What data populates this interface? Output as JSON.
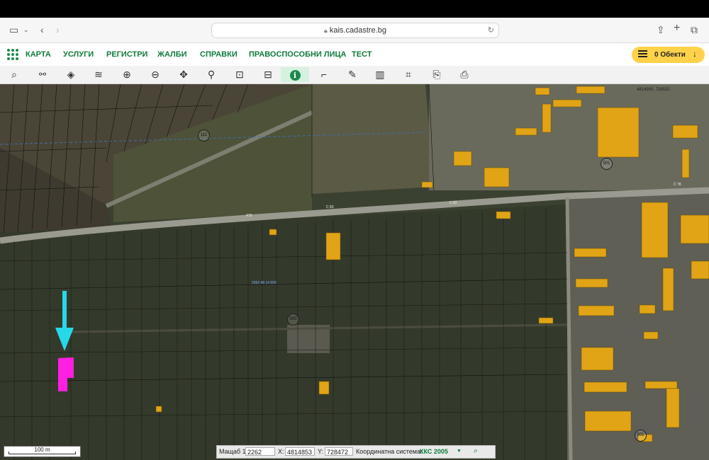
{
  "browser": {
    "url": "kais.cadastre.bg"
  },
  "menu": {
    "items": [
      "КАРТА",
      "УСЛУГИ",
      "РЕГИСТРИ",
      "ЖАЛБИ",
      "СПРАВКИ",
      "ПРАВОСПОСОБНИ ЛИЦА",
      "ТЕСТ"
    ],
    "objects_label": "0 Обекти"
  },
  "toolbar": {
    "tools": [
      "search-icon",
      "network-icon",
      "layers-icon",
      "layers-outline-icon",
      "zoom-in-icon",
      "zoom-out-icon",
      "pan-icon",
      "location-pin-icon",
      "add-rectangle-icon",
      "remove-rectangle-icon",
      "info-icon",
      "measure-icon",
      "draw-icon",
      "map-book-icon",
      "crop-icon",
      "export-icon",
      "print-icon"
    ],
    "active": "info-icon"
  },
  "map": {
    "parcel_circles": [
      "111",
      "501",
      "500",
      "501"
    ],
    "road_labels": [
      "C 83",
      "479",
      "C 82",
      "C 78"
    ],
    "corner_coords": "4814900, 728532",
    "mid_label": "2392 48 14 600",
    "colors": {
      "building": "#e0a416",
      "highlight": "#ff1fe0",
      "arrow": "#26d9e8",
      "parcel_line": "#1a1a1a"
    }
  },
  "scale": {
    "label": "100 m"
  },
  "status": {
    "scale_label": "Мащаб 1:",
    "scale_value": "2262",
    "x_label": "X:",
    "x_value": "4814853",
    "y_label": "Y:",
    "y_value": "728472",
    "crs_label": "Координатна система:",
    "crs_value": "ККС 2005"
  }
}
